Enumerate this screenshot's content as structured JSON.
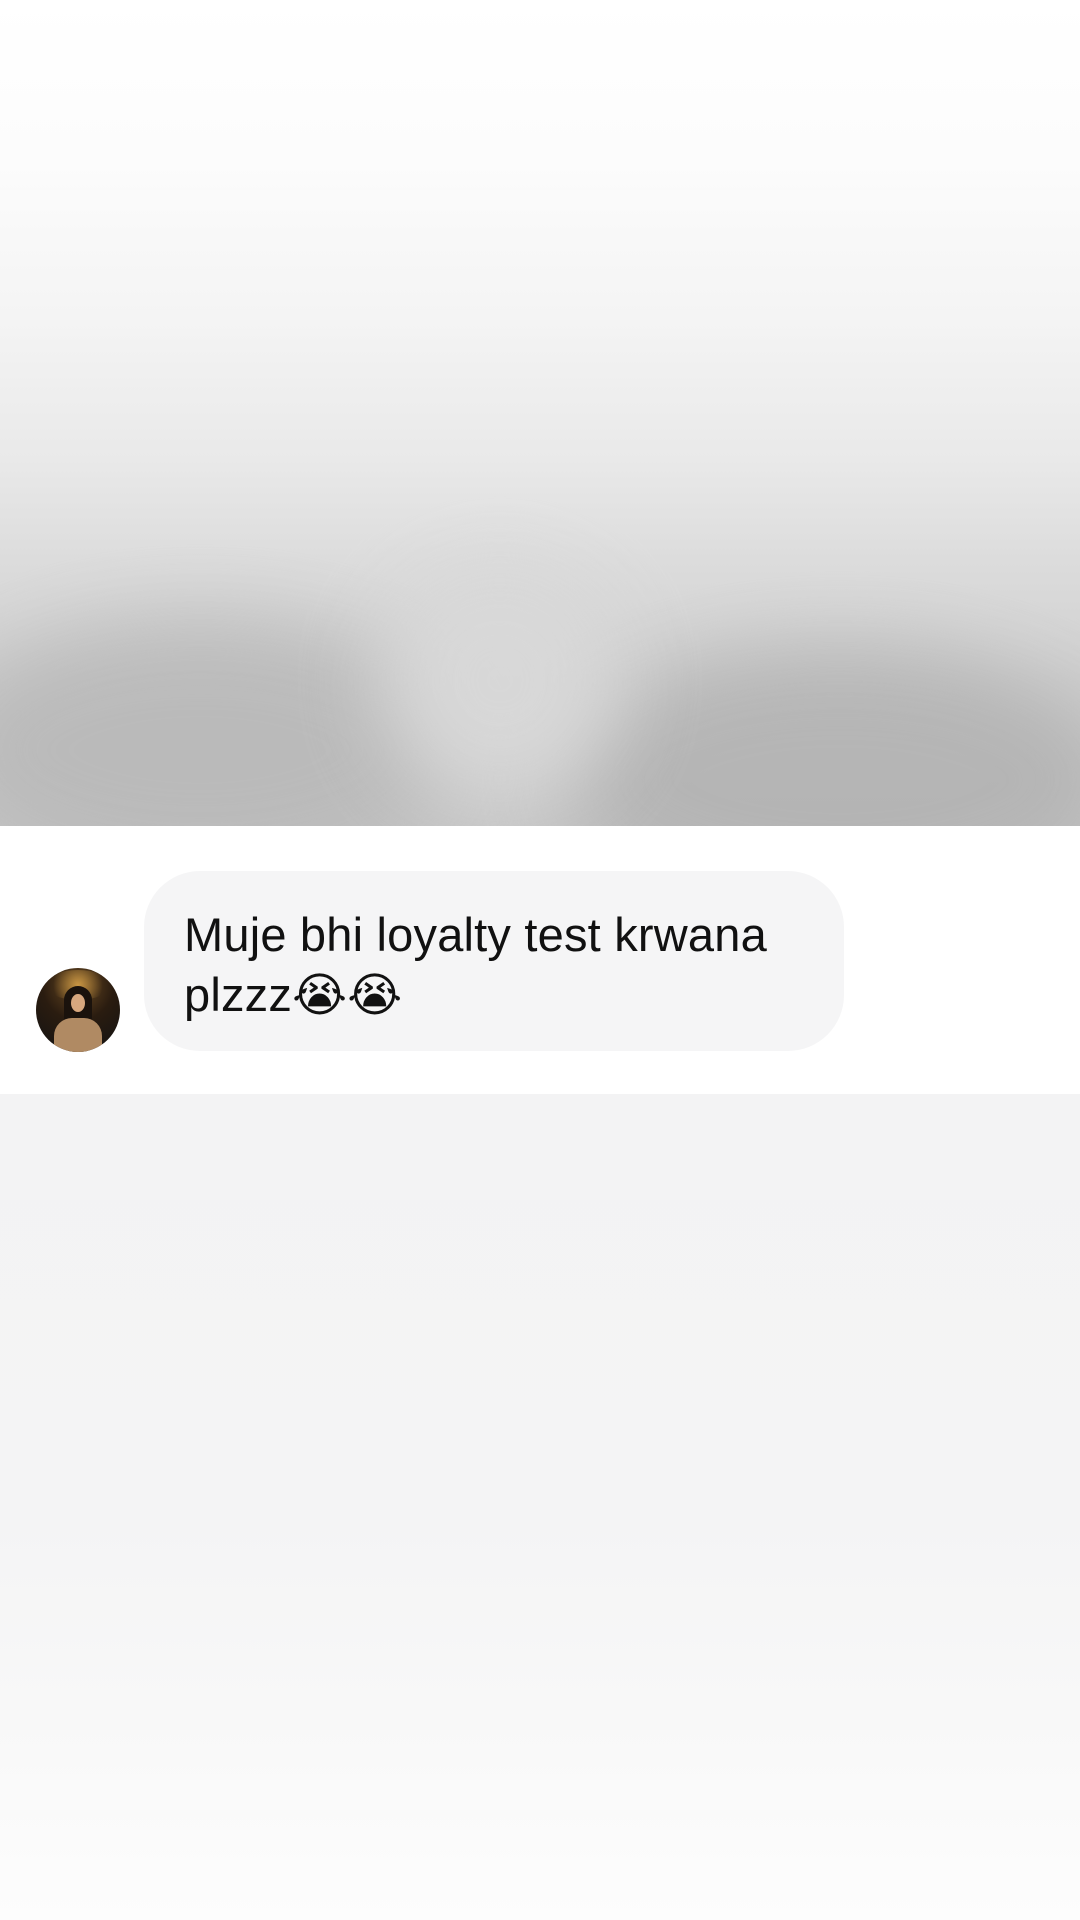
{
  "message": {
    "text": "Muje bhi loyalty test krwana plzzz😭😭"
  },
  "avatar": {
    "icon": "profile-avatar"
  }
}
